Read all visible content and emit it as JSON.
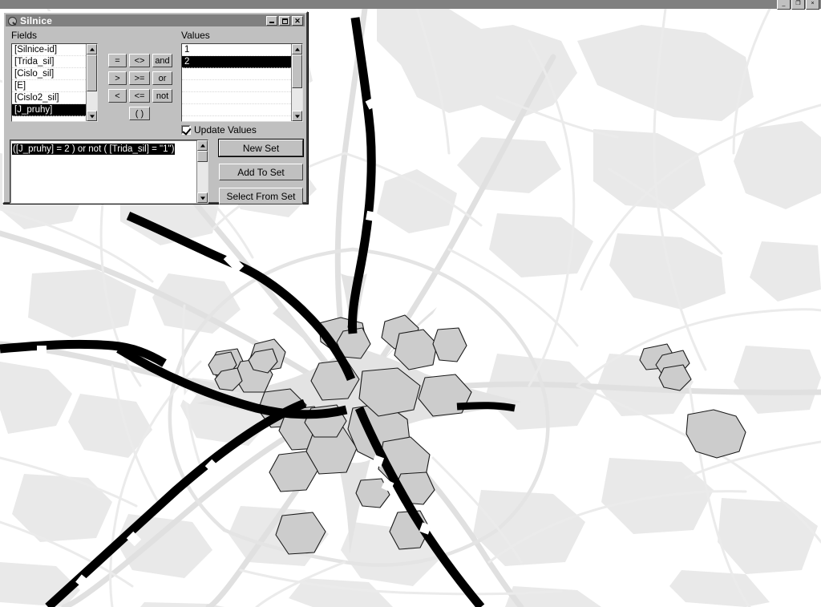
{
  "window_controls": {
    "mdi_minimize": "_",
    "mdi_restore": "❐",
    "mdi_close": "×"
  },
  "dialog": {
    "title": "Silnice",
    "icon": "magnifier-icon",
    "titlebar_buttons": {
      "minimize": "",
      "maximize": "",
      "close": "✕"
    },
    "fields_label": "Fields",
    "values_label": "Values",
    "fields": [
      {
        "label": "[Silnice-id]",
        "selected": false
      },
      {
        "label": "[Trida_sil]",
        "selected": false
      },
      {
        "label": "[Cislo_sil]",
        "selected": false
      },
      {
        "label": "[E]",
        "selected": false
      },
      {
        "label": "[Cislo2_sil]",
        "selected": false
      },
      {
        "label": "[J_pruhy]",
        "selected": true
      },
      {
        "label": "",
        "selected": false
      }
    ],
    "values": [
      {
        "label": "1",
        "selected": false
      },
      {
        "label": "2",
        "selected": true
      },
      {
        "label": "",
        "selected": false
      },
      {
        "label": "",
        "selected": false
      },
      {
        "label": "",
        "selected": false
      },
      {
        "label": "",
        "selected": false
      }
    ],
    "operators": [
      {
        "label": "=",
        "name": "equals"
      },
      {
        "label": "<>",
        "name": "not-equals"
      },
      {
        "label": "and",
        "name": "and"
      },
      {
        "label": ">",
        "name": "greater-than"
      },
      {
        "label": ">=",
        "name": "greater-or-equal"
      },
      {
        "label": "or",
        "name": "or"
      },
      {
        "label": "<",
        "name": "less-than"
      },
      {
        "label": "<=",
        "name": "less-or-equal"
      },
      {
        "label": "not",
        "name": "not"
      }
    ],
    "paren_button": "( )",
    "update_values_label": "Update Values",
    "update_values_checked": true,
    "expression": "([J_pruhy] = 2 ) or not ( [Trida_sil] = \"1\")",
    "buttons": {
      "new_set": "New Set",
      "add_to_set": "Add To Set",
      "select_from_set": "Select From Set"
    }
  },
  "map": {
    "description": "GIS road network map of a radial city with selected roads shown in thick black",
    "colors": {
      "background": "#ffffff",
      "urban_polygon_fill": "#e9e9e9",
      "builtup_polygon_fill": "#cccccc",
      "builtup_polygon_stroke": "#1a1a1a",
      "road_unselected": "#e0e0e0",
      "road_selected": "#000000",
      "desktop": "#808080"
    }
  }
}
